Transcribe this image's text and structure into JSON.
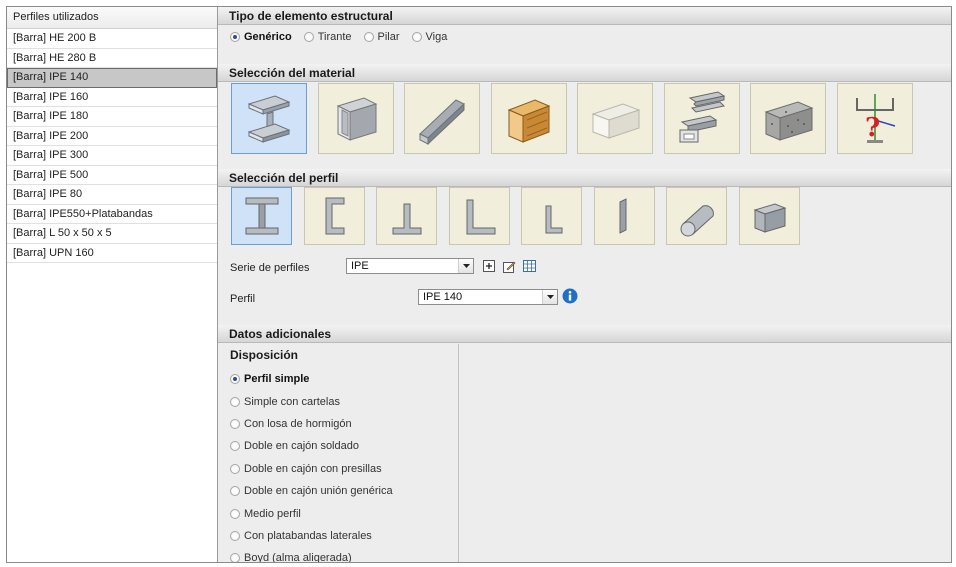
{
  "left_panel": {
    "header": "Perfiles utilizados",
    "items": [
      "[Barra] HE 200 B",
      "[Barra] HE 280 B",
      "[Barra] IPE 140",
      "[Barra] IPE 160",
      "[Barra] IPE 180",
      "[Barra] IPE 200",
      "[Barra] IPE 300",
      "[Barra] IPE 500",
      "[Barra] IPE 80",
      "[Barra] IPE550+Platabandas",
      "[Barra] L 50 x 50 x 5",
      "[Barra] UPN 160"
    ],
    "selected_index": 2
  },
  "tipo": {
    "title": "Tipo de elemento estructural",
    "options": [
      "Genérico",
      "Tirante",
      "Pilar",
      "Viga"
    ],
    "selected": "Genérico"
  },
  "material": {
    "title": "Selección del material",
    "icons": [
      "steel-i-beam-icon",
      "aluminum-profile-icon",
      "cold-formed-steel-icon",
      "wood-beam-icon",
      "generic-material-icon",
      "aluminum-extrusion-icon",
      "concrete-block-icon",
      "custom-section-icon"
    ],
    "selected_index": 0
  },
  "perfil_sel": {
    "title": "Selección del perfil",
    "icons": [
      "i-section-icon",
      "c-section-icon",
      "t-section-icon",
      "l-angle-icon",
      "small-angle-icon",
      "plate-icon",
      "round-bar-icon",
      "square-bar-icon"
    ],
    "selected_index": 0
  },
  "serie": {
    "label": "Serie de perfiles",
    "value": "IPE"
  },
  "perfil": {
    "label": "Perfil",
    "value": "IPE 140"
  },
  "adicionales": {
    "title": "Datos adicionales",
    "disposicion_title": "Disposición",
    "options": [
      "Perfil simple",
      "Simple con cartelas",
      "Con losa de hormigón",
      "Doble en cajón soldado",
      "Doble en cajón con presillas",
      "Doble en cajón unión genérica",
      "Medio perfil",
      "Con platabandas laterales",
      "Boyd (alma aligerada)"
    ],
    "selected_index": 0
  },
  "colors": {
    "selection_blue": "#cfe2f8",
    "tile_beige": "#f1eedc",
    "panel_gray": "#ededed",
    "info_blue": "#1f6fc5"
  }
}
